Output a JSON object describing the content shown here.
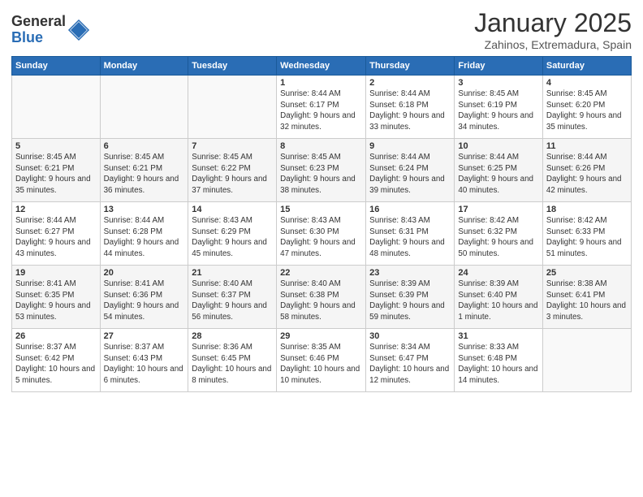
{
  "header": {
    "logo_line1": "General",
    "logo_line2": "Blue",
    "title": "January 2025",
    "subtitle": "Zahinos, Extremadura, Spain"
  },
  "days_of_week": [
    "Sunday",
    "Monday",
    "Tuesday",
    "Wednesday",
    "Thursday",
    "Friday",
    "Saturday"
  ],
  "weeks": [
    [
      {
        "day": "",
        "info": ""
      },
      {
        "day": "",
        "info": ""
      },
      {
        "day": "",
        "info": ""
      },
      {
        "day": "1",
        "info": "Sunrise: 8:44 AM\nSunset: 6:17 PM\nDaylight: 9 hours\nand 32 minutes."
      },
      {
        "day": "2",
        "info": "Sunrise: 8:44 AM\nSunset: 6:18 PM\nDaylight: 9 hours\nand 33 minutes."
      },
      {
        "day": "3",
        "info": "Sunrise: 8:45 AM\nSunset: 6:19 PM\nDaylight: 9 hours\nand 34 minutes."
      },
      {
        "day": "4",
        "info": "Sunrise: 8:45 AM\nSunset: 6:20 PM\nDaylight: 9 hours\nand 35 minutes."
      }
    ],
    [
      {
        "day": "5",
        "info": "Sunrise: 8:45 AM\nSunset: 6:21 PM\nDaylight: 9 hours\nand 35 minutes."
      },
      {
        "day": "6",
        "info": "Sunrise: 8:45 AM\nSunset: 6:21 PM\nDaylight: 9 hours\nand 36 minutes."
      },
      {
        "day": "7",
        "info": "Sunrise: 8:45 AM\nSunset: 6:22 PM\nDaylight: 9 hours\nand 37 minutes."
      },
      {
        "day": "8",
        "info": "Sunrise: 8:45 AM\nSunset: 6:23 PM\nDaylight: 9 hours\nand 38 minutes."
      },
      {
        "day": "9",
        "info": "Sunrise: 8:44 AM\nSunset: 6:24 PM\nDaylight: 9 hours\nand 39 minutes."
      },
      {
        "day": "10",
        "info": "Sunrise: 8:44 AM\nSunset: 6:25 PM\nDaylight: 9 hours\nand 40 minutes."
      },
      {
        "day": "11",
        "info": "Sunrise: 8:44 AM\nSunset: 6:26 PM\nDaylight: 9 hours\nand 42 minutes."
      }
    ],
    [
      {
        "day": "12",
        "info": "Sunrise: 8:44 AM\nSunset: 6:27 PM\nDaylight: 9 hours\nand 43 minutes."
      },
      {
        "day": "13",
        "info": "Sunrise: 8:44 AM\nSunset: 6:28 PM\nDaylight: 9 hours\nand 44 minutes."
      },
      {
        "day": "14",
        "info": "Sunrise: 8:43 AM\nSunset: 6:29 PM\nDaylight: 9 hours\nand 45 minutes."
      },
      {
        "day": "15",
        "info": "Sunrise: 8:43 AM\nSunset: 6:30 PM\nDaylight: 9 hours\nand 47 minutes."
      },
      {
        "day": "16",
        "info": "Sunrise: 8:43 AM\nSunset: 6:31 PM\nDaylight: 9 hours\nand 48 minutes."
      },
      {
        "day": "17",
        "info": "Sunrise: 8:42 AM\nSunset: 6:32 PM\nDaylight: 9 hours\nand 50 minutes."
      },
      {
        "day": "18",
        "info": "Sunrise: 8:42 AM\nSunset: 6:33 PM\nDaylight: 9 hours\nand 51 minutes."
      }
    ],
    [
      {
        "day": "19",
        "info": "Sunrise: 8:41 AM\nSunset: 6:35 PM\nDaylight: 9 hours\nand 53 minutes."
      },
      {
        "day": "20",
        "info": "Sunrise: 8:41 AM\nSunset: 6:36 PM\nDaylight: 9 hours\nand 54 minutes."
      },
      {
        "day": "21",
        "info": "Sunrise: 8:40 AM\nSunset: 6:37 PM\nDaylight: 9 hours\nand 56 minutes."
      },
      {
        "day": "22",
        "info": "Sunrise: 8:40 AM\nSunset: 6:38 PM\nDaylight: 9 hours\nand 58 minutes."
      },
      {
        "day": "23",
        "info": "Sunrise: 8:39 AM\nSunset: 6:39 PM\nDaylight: 9 hours\nand 59 minutes."
      },
      {
        "day": "24",
        "info": "Sunrise: 8:39 AM\nSunset: 6:40 PM\nDaylight: 10 hours\nand 1 minute."
      },
      {
        "day": "25",
        "info": "Sunrise: 8:38 AM\nSunset: 6:41 PM\nDaylight: 10 hours\nand 3 minutes."
      }
    ],
    [
      {
        "day": "26",
        "info": "Sunrise: 8:37 AM\nSunset: 6:42 PM\nDaylight: 10 hours\nand 5 minutes."
      },
      {
        "day": "27",
        "info": "Sunrise: 8:37 AM\nSunset: 6:43 PM\nDaylight: 10 hours\nand 6 minutes."
      },
      {
        "day": "28",
        "info": "Sunrise: 8:36 AM\nSunset: 6:45 PM\nDaylight: 10 hours\nand 8 minutes."
      },
      {
        "day": "29",
        "info": "Sunrise: 8:35 AM\nSunset: 6:46 PM\nDaylight: 10 hours\nand 10 minutes."
      },
      {
        "day": "30",
        "info": "Sunrise: 8:34 AM\nSunset: 6:47 PM\nDaylight: 10 hours\nand 12 minutes."
      },
      {
        "day": "31",
        "info": "Sunrise: 8:33 AM\nSunset: 6:48 PM\nDaylight: 10 hours\nand 14 minutes."
      },
      {
        "day": "",
        "info": ""
      }
    ]
  ]
}
